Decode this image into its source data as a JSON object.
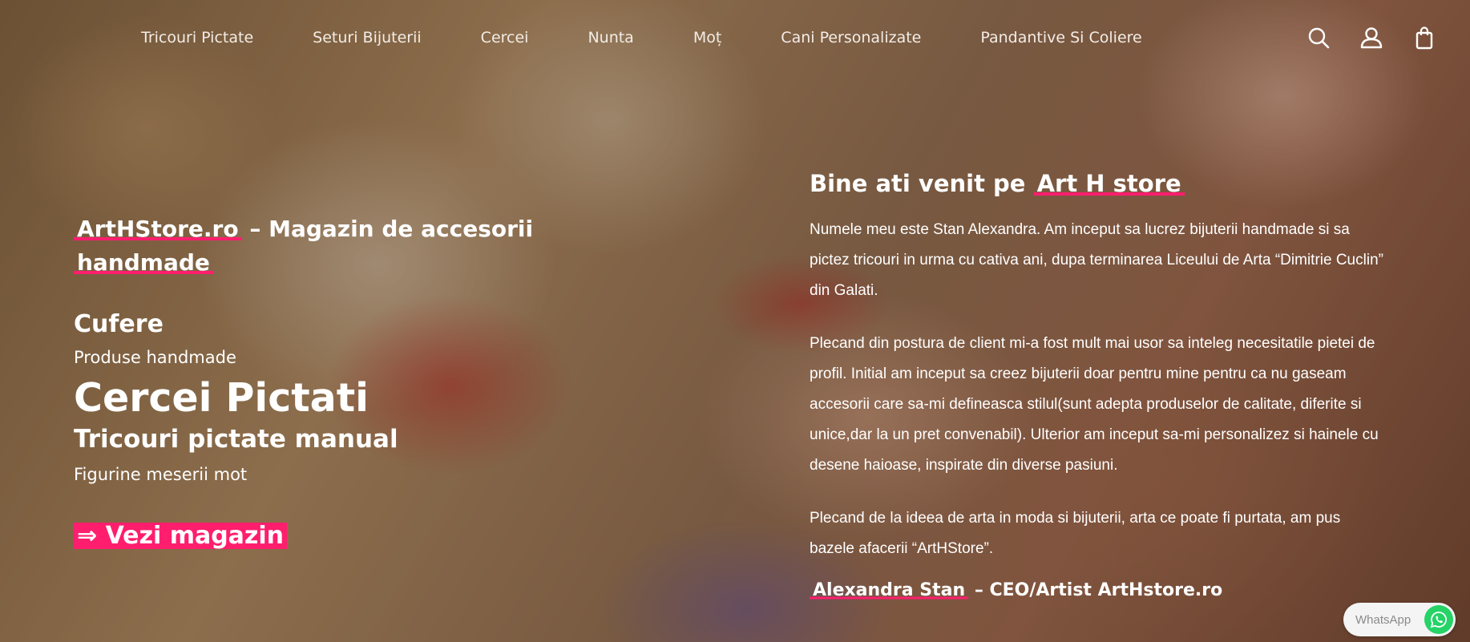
{
  "nav": {
    "items": [
      "Tricouri Pictate",
      "Seturi Bijuterii",
      "Cercei",
      "Nunta",
      "Moț",
      "Cani Personalizate",
      "Pandantive Si Coliere"
    ],
    "icons": [
      "search-icon",
      "user-icon",
      "bag-icon"
    ]
  },
  "hero_left": {
    "title_highlight": "ArtHStore.ro",
    "title_rest": " – Magazin de accesorii ",
    "title_highlight2": "handmade",
    "line1": "Cufere",
    "line2": "Produse handmade",
    "line3": "Cercei Pictati",
    "line4": "Tricouri pictate manual",
    "line5": "Figurine meserii mot",
    "cta": "⇒ Vezi magazin"
  },
  "hero_right": {
    "title_prefix": "Bine ati venit pe ",
    "title_highlight": "Art H store",
    "paragraph1": "Numele meu este Stan Alexandra. Am inceput sa lucrez bijuterii handmade si sa pictez tricouri in urma cu cativa ani, dupa terminarea Liceului de Arta “Dimitrie Cuclin” din Galati.",
    "paragraph2": "Plecand din postura de client mi-a fost mult mai usor sa inteleg necesitatile pietei de profil. Initial am inceput sa creez bijuterii doar pentru mine pentru ca nu gaseam accesorii care sa-mi defineasca stilul(sunt adepta produselor de calitate, diferite si unice,dar la un pret convenabil). Ulterior am inceput sa-mi personalizez si hainele cu desene haioase, inspirate din diverse pasiuni.",
    "paragraph3": "Plecand de la ideea de arta in moda si bijuterii, arta ce poate fi purtata, am pus bazele afacerii “ArtHStore”.",
    "signature_highlight": "Alexandra Stan",
    "signature_rest": " – CEO/Artist ArtHstore.ro"
  },
  "whatsapp": {
    "label": "WhatsApp"
  },
  "colors": {
    "accent": "#ff1e6e",
    "whatsapp": "#25d366"
  }
}
